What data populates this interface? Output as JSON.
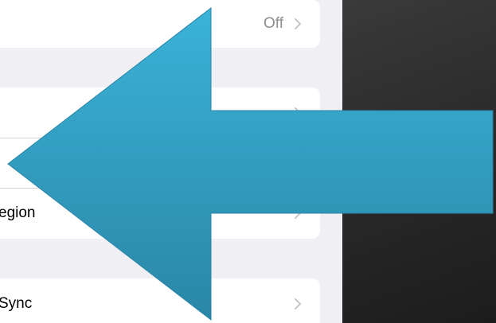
{
  "settings": {
    "rows": [
      {
        "label": "",
        "value": "Off"
      },
      {
        "label": "",
        "value": ""
      },
      {
        "label": "",
        "value": ""
      },
      {
        "label": "egion",
        "value": ""
      },
      {
        "label": "Sync",
        "value": ""
      }
    ]
  },
  "overlay": {
    "arrow_color": "#35a8cf",
    "direction": "left"
  }
}
